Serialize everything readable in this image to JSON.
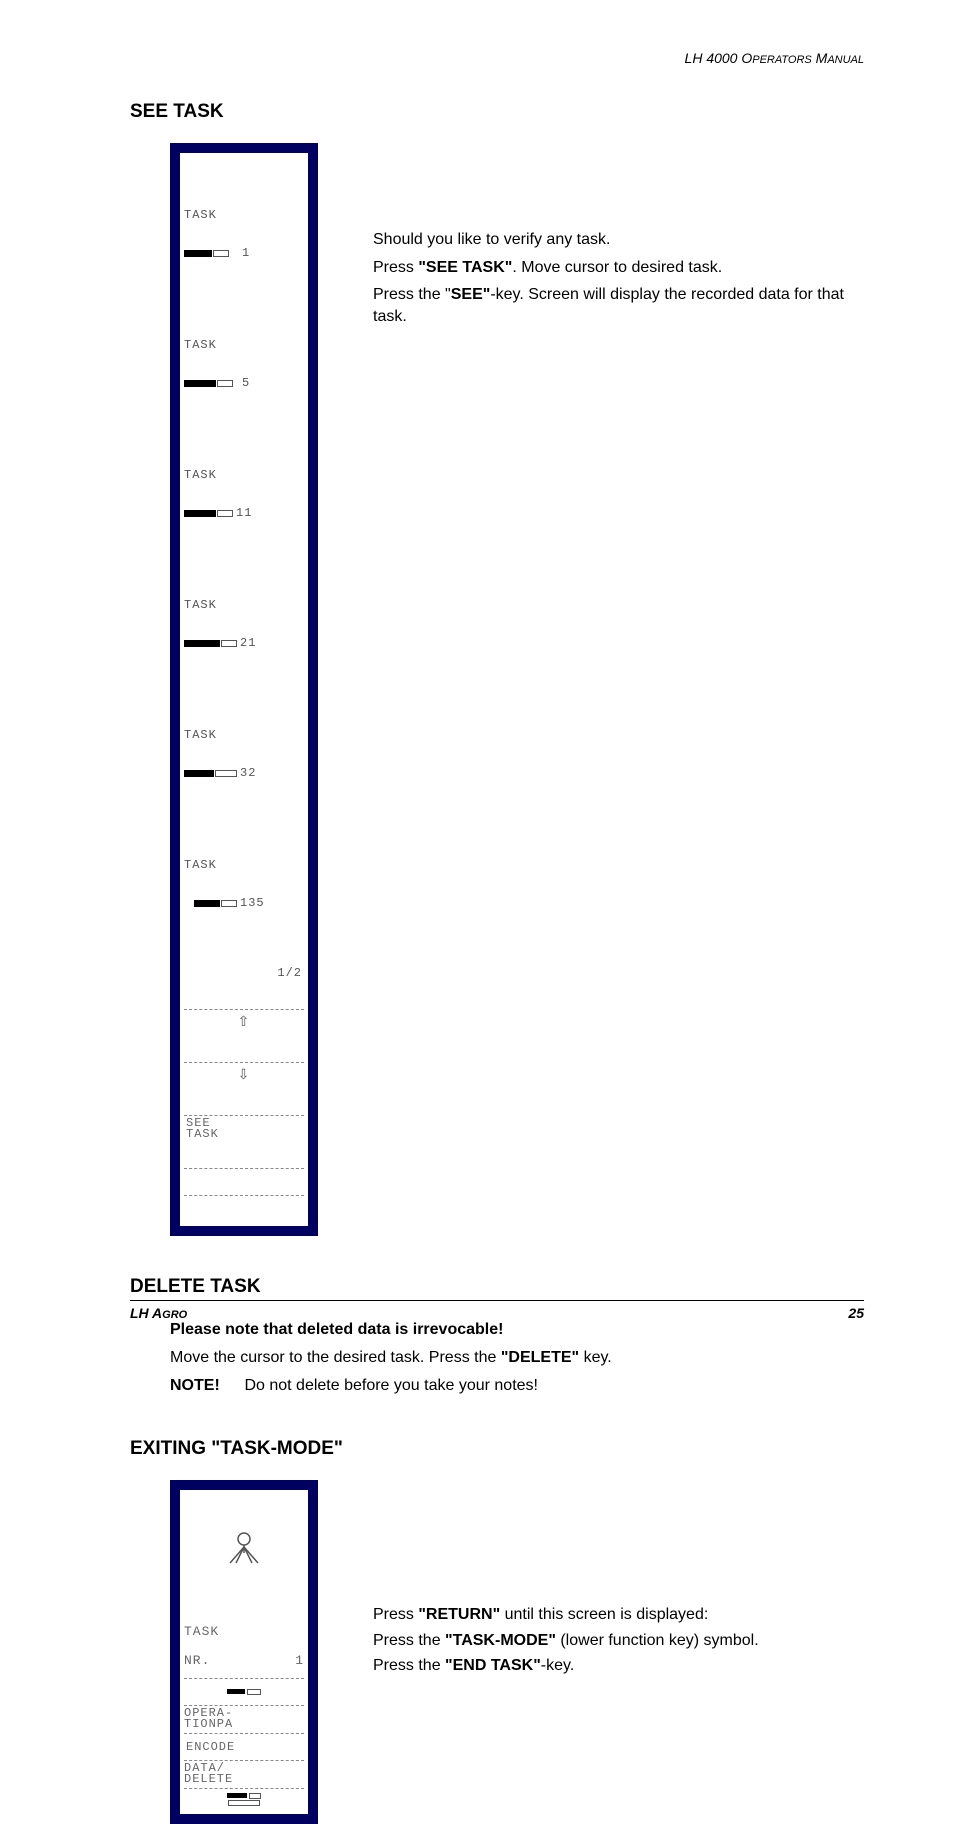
{
  "header": {
    "doc_title": "LH 4000 Operators Manual"
  },
  "see_task": {
    "heading": "SEE TASK",
    "device": {
      "tasks": [
        {
          "label": "TASK",
          "num": "1"
        },
        {
          "label": "TASK",
          "num": "5"
        },
        {
          "label": "TASK",
          "num": "11"
        },
        {
          "label": "TASK",
          "num": "21"
        },
        {
          "label": "TASK",
          "num": "32"
        },
        {
          "label": "TASK",
          "num": "135"
        }
      ],
      "page_indicator": "1/2",
      "soft_key": "SEE\nTASK"
    },
    "para1": "Should you like to verify any task.",
    "para2a": "Press ",
    "para2b": "\"SEE TASK\"",
    "para2c": ". Move cursor to desired task.",
    "para3a": "Press the \"",
    "para3b": "SEE\"",
    "para3c": "-key. Screen will display the recorded data for that task."
  },
  "delete_task": {
    "heading": "DELETE TASK",
    "warn": "Please note that deleted data is irrevocable!",
    "line1a": "Move the cursor to the desired task. Press the ",
    "line1b": "\"DELETE\"",
    "line1c": " key.",
    "note_label": "NOTE!",
    "note_text": "Do not delete before you take your notes!"
  },
  "exit_task": {
    "heading": "EXITING \"TASK-MODE\"",
    "device": {
      "task_label": "TASK",
      "nr_label": "NR.",
      "nr_value": "1",
      "row1": "OPERA-\nTIONPA",
      "row2": "ENCODE",
      "row3": "DATA/\nDELETE"
    },
    "para1a": "Press ",
    "para1b": "\"RETURN\"",
    "para1c": " until this screen is displayed:",
    "para2a": "Press the ",
    "para2b": "\"TASK-MODE\"",
    "para2c": " (lower function key) symbol.",
    "para3a": "Press the ",
    "para3b": "\"END TASK\"",
    "para3c": "-key."
  },
  "footer": {
    "left": "LH Agro",
    "right": "25"
  }
}
